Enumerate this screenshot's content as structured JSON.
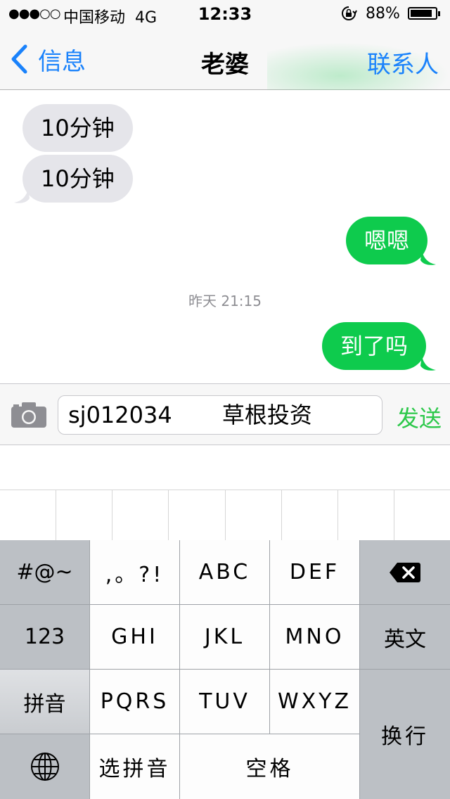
{
  "status_bar": {
    "signal": "●●●○○",
    "carrier": "中国移动",
    "network": "4G",
    "time": "12:33",
    "battery": "88%",
    "battery_level": 0.88
  },
  "nav": {
    "back_label": "信息",
    "title": "老婆",
    "contact_label": "联系人"
  },
  "messages": [
    {
      "direction": "incoming",
      "text": "10分钟"
    },
    {
      "direction": "incoming",
      "text": "10分钟"
    },
    {
      "direction": "outgoing",
      "text": "嗯嗯"
    },
    {
      "direction": "outgoing",
      "text": "到了吗"
    }
  ],
  "timestamp": "昨天 21:15",
  "input": {
    "value": "sj012034       草根投资",
    "send_label": "发送"
  },
  "keyboard": {
    "symbols": "#@~",
    "punct": ",。?!",
    "abc": "ABC",
    "def": "DEF",
    "num": "123",
    "ghi": "GHI",
    "jkl": "JKL",
    "mno": "MNO",
    "english": "英文",
    "pinyin": "拼音",
    "pqrs": "PQRS",
    "tuv": "TUV",
    "wxyz": "WXYZ",
    "enter": "换行",
    "select_pinyin": "选拼音",
    "space": "空格"
  }
}
